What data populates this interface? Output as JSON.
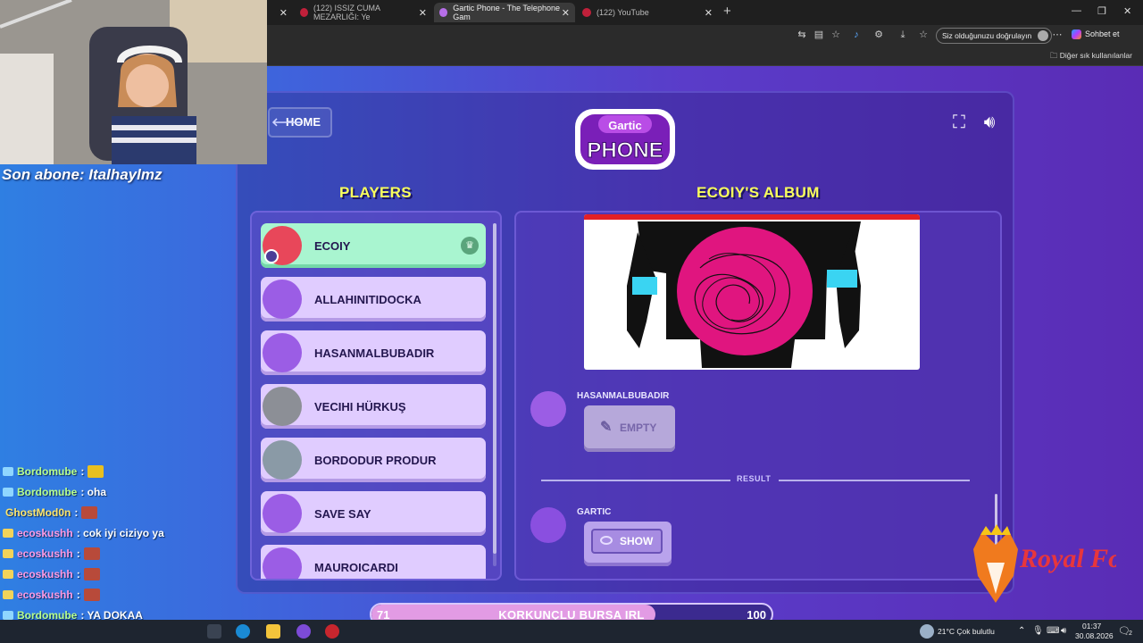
{
  "browser": {
    "tabs": [
      {
        "label": "(122) ISSIZ CUMA MEZARLIĞI: Ye",
        "active": false
      },
      {
        "label": "Gartic Phone - The Telephone Gam",
        "active": true
      },
      {
        "label": "(122) YouTube",
        "active": false
      }
    ],
    "signin_label": "Siz olduğunuzu doğrulayın",
    "chat_label": "Sohbet et",
    "bookmarks_label": "Diğer sık kullanılanlar"
  },
  "game": {
    "home_label": "HOME",
    "logo_top": "Gartic",
    "logo_bottom": "PHONE",
    "players_title": "PLAYERS",
    "album_title": "ECOIY'S ALBUM",
    "players": [
      {
        "name": "ECOIY",
        "avatar_color": "#e8475a",
        "active": true,
        "host": true
      },
      {
        "name": "ALLAHINITIDOCKA",
        "avatar_color": "#9b5de5"
      },
      {
        "name": "HASANMALBUBADIR",
        "avatar_color": "#9b5de5"
      },
      {
        "name": "VECIHI HÜRKUŞ",
        "avatar_color": "#8c8f96"
      },
      {
        "name": "BORDODUR PRODUR",
        "avatar_color": "#8a9aa6"
      },
      {
        "name": "SAVE SAY",
        "avatar_color": "#9b5de5"
      },
      {
        "name": "MAUROICARDI",
        "avatar_color": "#9b5de5"
      }
    ],
    "album": {
      "entry1_author": "HASANMALBUBADIR",
      "entry1_button": "EMPTY",
      "result_label": "RESULT",
      "entry2_author": "GARTIC",
      "entry2_button": "SHOW"
    },
    "progress": {
      "current": "71",
      "max": "100",
      "label": "KORKUNÇLU BURSA IRL",
      "fraction": 0.71
    }
  },
  "stream": {
    "last_sub": "Son abone: Italhaylmz",
    "chat": [
      {
        "user": "Bordomube",
        "msg": "",
        "emote": "y",
        "color": "green"
      },
      {
        "user": "Bordomube",
        "msg": ": oha",
        "emote": "",
        "color": "green"
      },
      {
        "user": "GhostMod0n",
        "msg": ":",
        "emote": "r",
        "color": "yellow"
      },
      {
        "user": "ecoskushh",
        "msg": ": cok iyi ciziyo ya",
        "emote": "",
        "color": "pink"
      },
      {
        "user": "ecoskushh",
        "msg": ":",
        "emote": "r",
        "color": "pink"
      },
      {
        "user": "ecoskushh",
        "msg": ":",
        "emote": "r",
        "color": "pink"
      },
      {
        "user": "ecoskushh",
        "msg": ":",
        "emote": "r",
        "color": "pink"
      },
      {
        "user": "Bordomube",
        "msg": ": YA DOKAA",
        "emote": "",
        "color": "green"
      }
    ],
    "brand": "Royal Foxes"
  },
  "taskbar": {
    "weather": "21°C  Çok bulutlu",
    "time": "01:37",
    "date": "30.08.2026",
    "notif_count": "2"
  },
  "colors": {
    "accent_yellow": "#f9ff5c",
    "active_player": "#a9f5d0",
    "player_bg": "#e0ccff",
    "ink_magenta": "#e0157f"
  }
}
